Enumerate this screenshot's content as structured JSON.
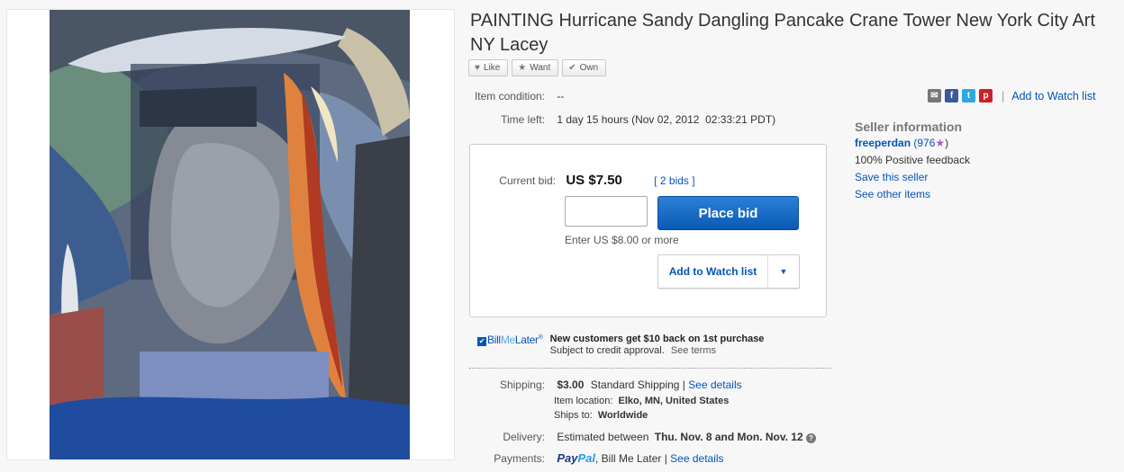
{
  "listing": {
    "title": "PAINTING Hurricane Sandy Dangling Pancake Crane Tower New York City Art NY Lacey"
  },
  "social": {
    "like": "Like",
    "want": "Want",
    "own": "Own"
  },
  "item": {
    "condition_label": "Item condition:",
    "condition_value": "--",
    "time_left_label": "Time left:",
    "time_left_value": "1 day 15 hours (Nov 02, 2012  02:33:21 PDT)"
  },
  "share": {
    "add_watch": "Add to Watch list",
    "icons": [
      "email-icon",
      "facebook-icon",
      "twitter-icon",
      "pinterest-icon"
    ]
  },
  "bid": {
    "current_label": "Current bid:",
    "current_value": "US $7.50",
    "bids_link": "[ 2 bids ]",
    "input_value": "",
    "place_bid": "Place bid",
    "hint": "Enter US $8.00 or more",
    "watch_button": "Add to Watch list"
  },
  "billmelater": {
    "logo_bill": "Bill",
    "logo_me": "Me",
    "logo_later": "Later",
    "logo_mark": "®",
    "headline": "New customers get $10 back on 1st purchase",
    "sub": "Subject to credit approval.",
    "see_terms": "See terms"
  },
  "shipping": {
    "label": "Shipping:",
    "cost": "$3.00",
    "method": "Standard Shipping |",
    "details": "See details",
    "location_label": "Item location:",
    "location_value": "Elko, MN, United States",
    "ships_label": "Ships to:",
    "ships_value": "Worldwide"
  },
  "delivery": {
    "label": "Delivery:",
    "prefix": "Estimated between",
    "range": "Thu. Nov. 8 and Mon. Nov. 12"
  },
  "payments": {
    "label": "Payments:",
    "paypal_1": "Pay",
    "paypal_2": "Pal",
    "rest": ", Bill Me Later |",
    "details": "See details"
  },
  "seller": {
    "heading": "Seller information",
    "name": "freeperdan",
    "score": "(976",
    "score_close": ")",
    "positive": "100% Positive feedback",
    "save": "Save this seller",
    "other": "See other items"
  },
  "colors": {
    "link": "#0654ba",
    "bid_button": "#0a5bb5",
    "facebook": "#3b5998",
    "twitter": "#2ba9e1",
    "pinterest": "#cb2027",
    "star": "#a55fc7"
  }
}
